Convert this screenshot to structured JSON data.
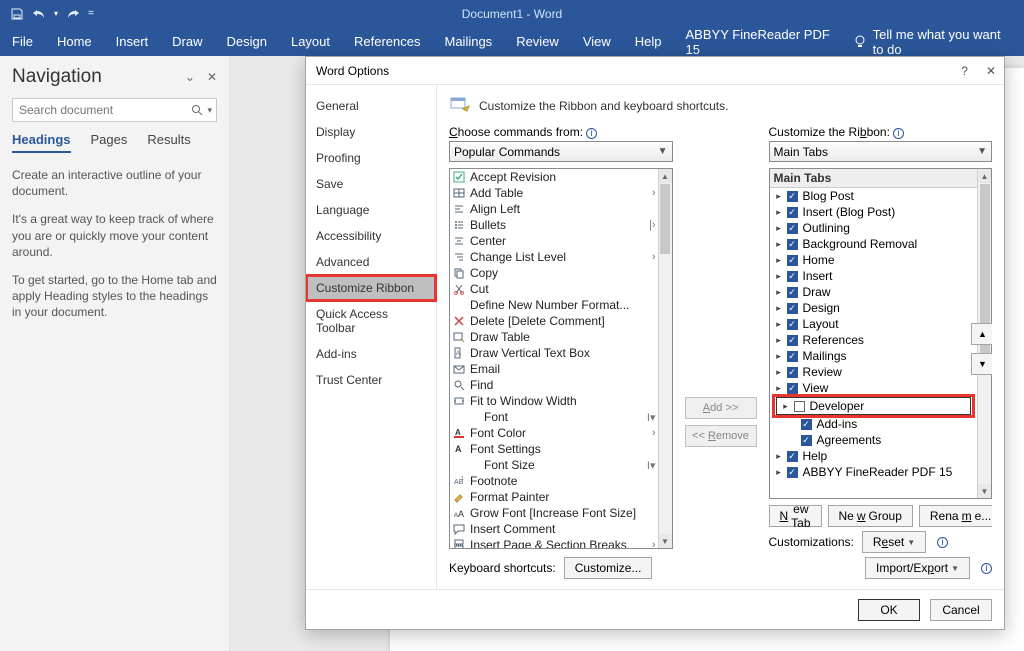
{
  "titlebar": {
    "document_title": "Document1 - Word"
  },
  "qat_icons": [
    "save-icon",
    "undo-icon",
    "redo-icon",
    "customize-qat-icon"
  ],
  "ribbon_tabs": [
    "File",
    "Home",
    "Insert",
    "Draw",
    "Design",
    "Layout",
    "References",
    "Mailings",
    "Review",
    "View",
    "Help",
    "ABBYY FineReader PDF 15"
  ],
  "tell_me": "Tell me what you want to do",
  "navigation": {
    "title": "Navigation",
    "search_placeholder": "Search document",
    "tabs": [
      "Headings",
      "Pages",
      "Results"
    ],
    "active_tab": "Headings",
    "para1": "Create an interactive outline of your document.",
    "para2": "It's a great way to keep track of where you are or quickly move your content around.",
    "para3": "To get started, go to the Home tab and apply Heading styles to the headings in your document."
  },
  "dialog": {
    "title": "Word Options",
    "help": "?",
    "close": "✕",
    "sidebar": [
      "General",
      "Display",
      "Proofing",
      "Save",
      "Language",
      "Accessibility",
      "Advanced",
      "Customize Ribbon",
      "Quick Access Toolbar",
      "Add-ins",
      "Trust Center"
    ],
    "sidebar_selected": "Customize Ribbon",
    "banner": "Customize the Ribbon and keyboard shortcuts.",
    "left": {
      "label": "Choose commands from:",
      "combo": "Popular Commands",
      "items": [
        {
          "icon": "check",
          "text": "Accept Revision"
        },
        {
          "icon": "table",
          "text": "Add Table",
          "sub": "›"
        },
        {
          "icon": "align",
          "text": "Align Left"
        },
        {
          "icon": "bullets",
          "text": "Bullets",
          "sub": "|›"
        },
        {
          "icon": "center",
          "text": "Center"
        },
        {
          "icon": "list",
          "text": "Change List Level",
          "sub": "›"
        },
        {
          "icon": "copy",
          "text": "Copy"
        },
        {
          "icon": "cut",
          "text": "Cut"
        },
        {
          "icon": "blank",
          "text": "Define New Number Format..."
        },
        {
          "icon": "delete",
          "text": "Delete [Delete Comment]"
        },
        {
          "icon": "drawtable",
          "text": "Draw Table"
        },
        {
          "icon": "textbox",
          "text": "Draw Vertical Text Box"
        },
        {
          "icon": "email",
          "text": "Email"
        },
        {
          "icon": "find",
          "text": "Find"
        },
        {
          "icon": "fit",
          "text": "Fit to Window Width"
        },
        {
          "icon": "blank",
          "text": "Font",
          "indent": true,
          "sub": "I▾"
        },
        {
          "icon": "fontcolor",
          "text": "Font Color",
          "sub": "›"
        },
        {
          "icon": "fontset",
          "text": "Font Settings"
        },
        {
          "icon": "blank",
          "text": "Font Size",
          "indent": true,
          "sub": "I▾"
        },
        {
          "icon": "footnote",
          "text": "Footnote"
        },
        {
          "icon": "brush",
          "text": "Format Painter"
        },
        {
          "icon": "grow",
          "text": "Grow Font [Increase Font Size]"
        },
        {
          "icon": "comment",
          "text": "Insert Comment"
        },
        {
          "icon": "pagebreak",
          "text": "Insert Page & Section Breaks",
          "sub": "›"
        }
      ]
    },
    "mid": {
      "add": "Add >>",
      "remove": "<< Remove"
    },
    "right": {
      "label": "Customize the Ribbon:",
      "combo": "Main Tabs",
      "header": "Main Tabs",
      "items": [
        {
          "name": "Blog Post",
          "checked": true,
          "exp": true
        },
        {
          "name": "Insert (Blog Post)",
          "checked": true,
          "exp": true
        },
        {
          "name": "Outlining",
          "checked": true,
          "exp": true
        },
        {
          "name": "Background Removal",
          "checked": true,
          "exp": true
        },
        {
          "name": "Home",
          "checked": true,
          "exp": true
        },
        {
          "name": "Insert",
          "checked": true,
          "exp": true
        },
        {
          "name": "Draw",
          "checked": true,
          "exp": true
        },
        {
          "name": "Design",
          "checked": true,
          "exp": true
        },
        {
          "name": "Layout",
          "checked": true,
          "exp": true
        },
        {
          "name": "References",
          "checked": true,
          "exp": true
        },
        {
          "name": "Mailings",
          "checked": true,
          "exp": true
        },
        {
          "name": "Review",
          "checked": true,
          "exp": true
        },
        {
          "name": "View",
          "checked": true,
          "exp": true
        },
        {
          "name": "Developer",
          "checked": false,
          "exp": true,
          "highlight": true,
          "selected": true
        },
        {
          "name": "Add-ins",
          "checked": true,
          "exp": false,
          "indent": true
        },
        {
          "name": "Agreements",
          "checked": true,
          "exp": false,
          "indent": true
        },
        {
          "name": "Help",
          "checked": true,
          "exp": true
        },
        {
          "name": "ABBYY FineReader PDF 15",
          "checked": true,
          "exp": true
        }
      ]
    },
    "under_buttons": {
      "new_tab": "New Tab",
      "new_group": "New Group",
      "rename": "Rename..."
    },
    "customizations_label": "Customizations:",
    "reset": "Reset",
    "import_export": "Import/Export",
    "kbd_label": "Keyboard shortcuts:",
    "customize_btn": "Customize...",
    "ok": "OK",
    "cancel": "Cancel",
    "move_up": "▲",
    "move_down": "▼"
  }
}
